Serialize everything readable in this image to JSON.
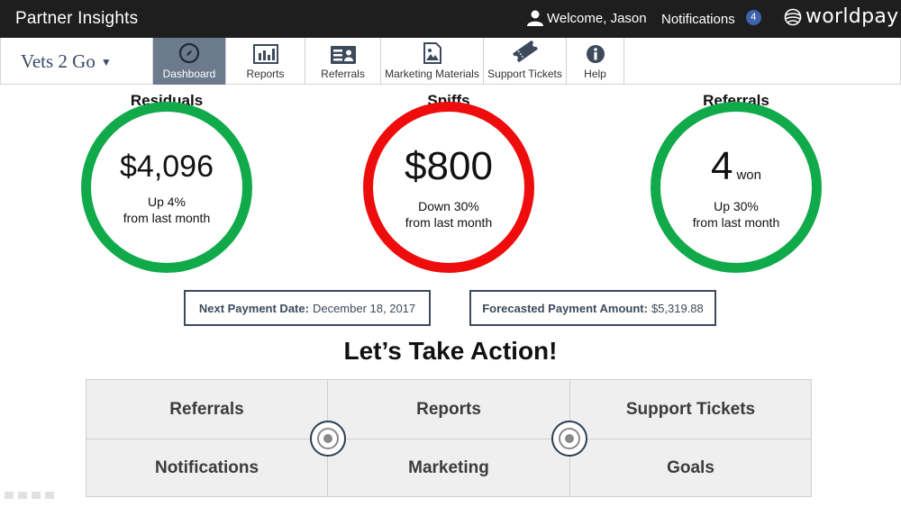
{
  "header": {
    "app_title": "Partner Insights",
    "welcome": "Welcome, Jason",
    "notifications_label": "Notifications",
    "notifications_count": "4",
    "brand": "worldpay"
  },
  "nav": {
    "org_name": "Vets 2 Go",
    "tabs": [
      {
        "label": "Dashboard",
        "icon": "compass-icon",
        "active": true
      },
      {
        "label": "Reports",
        "icon": "bar-chart-icon"
      },
      {
        "label": "Referrals",
        "icon": "id-card-icon"
      },
      {
        "label": "Marketing Materials",
        "icon": "image-icon"
      },
      {
        "label": "Support Tickets",
        "icon": "ticket-icon"
      },
      {
        "label": "Help",
        "icon": "info-icon"
      }
    ]
  },
  "stats": {
    "residuals": {
      "title": "Residuals",
      "value": "$4,096",
      "change": "Up 4%",
      "period": "from last month",
      "color": "#11aa4a"
    },
    "spiffs": {
      "title": "Spiffs",
      "value": "$800",
      "change": "Down 30%",
      "period": "from last month",
      "color": "#ee0c0c"
    },
    "referrals": {
      "title": "Referrals",
      "value": "4",
      "unit": "won",
      "change": "Up 30%",
      "period": "from last month",
      "color": "#11aa4a"
    }
  },
  "payment": {
    "next_date_label": "Next Payment Date:",
    "next_date_value": "December 18, 2017",
    "forecast_label": "Forecasted Payment Amount:",
    "forecast_value": "$5,319.88"
  },
  "actions": {
    "title": "Let’s Take Action!",
    "items": [
      "Referrals",
      "Reports",
      "Support Tickets",
      "Notifications",
      "Marketing",
      "Goals"
    ]
  }
}
